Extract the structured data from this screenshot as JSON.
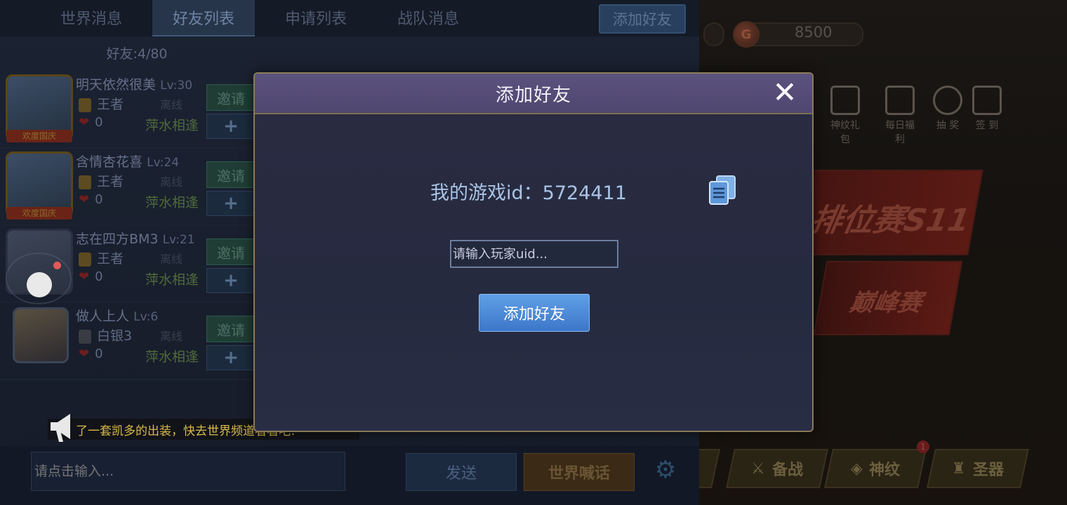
{
  "tabs": [
    {
      "label": "世界消息"
    },
    {
      "label": "好友列表"
    },
    {
      "label": "申请列表"
    },
    {
      "label": "战队消息"
    }
  ],
  "top_add_friend_label": "添加好友",
  "resources": {
    "gold": "8500"
  },
  "friend_count": "好友:4/80",
  "friends": [
    {
      "name": "明天依然很美",
      "level": "Lv:30",
      "rank": "王者",
      "status": "离线",
      "likes": "0",
      "channel": "萍水相逢",
      "frame_label": "欢度国庆",
      "invite": "邀请",
      "plus": "+"
    },
    {
      "name": "含情杏花喜",
      "level": "Lv:24",
      "rank": "王者",
      "status": "离线",
      "likes": "0",
      "channel": "萍水相逢",
      "frame_label": "欢度国庆",
      "invite": "邀请",
      "plus": "+"
    },
    {
      "name": "志在四方BM3",
      "level": "Lv:21",
      "rank": "王者",
      "status": "离线",
      "likes": "0",
      "channel": "萍水相逢",
      "frame_label": "",
      "invite": "邀请",
      "plus": "+"
    },
    {
      "name": "做人上人",
      "level": "Lv:6",
      "rank": "白银3",
      "status": "离线",
      "likes": "0",
      "channel": "萍水相逢",
      "frame_label": "",
      "invite": "邀请",
      "plus": "+"
    }
  ],
  "announcement": "了一套凯多的出装，快去世界频道看看吧!",
  "chat": {
    "placeholder": "请点击输入...",
    "send_label": "发送",
    "world_label": "世界喊话"
  },
  "bg_menu": [
    {
      "label": "神纹礼包"
    },
    {
      "label": "每日福利"
    },
    {
      "label": "抽 奖"
    },
    {
      "label": "签 到"
    }
  ],
  "bg_banners": {
    "ranked": "排位赛S11",
    "peak": "巅峰赛"
  },
  "bg_bottom_tabs": [
    {
      "label": "备战"
    },
    {
      "label": "神纹"
    },
    {
      "label": "圣器"
    }
  ],
  "bg_badge": "1",
  "modal": {
    "title": "添加好友",
    "my_id_label": "我的游戏id：",
    "my_id_value": "5724411",
    "uid_placeholder": "请输入玩家uid...",
    "add_button_label": "添加好友"
  },
  "colors": {
    "accent_blue": "#4a86d6",
    "modal_header": "#564c78",
    "gold_text": "#d9b94b"
  }
}
